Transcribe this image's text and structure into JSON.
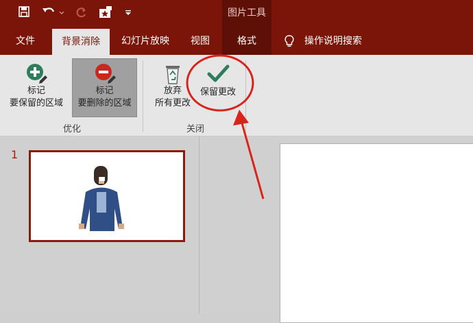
{
  "title_bar": {
    "context_group": "图片工具",
    "qat_icons": [
      "save-icon",
      "undo-icon",
      "redo-icon",
      "picture-icon",
      "customize-qat-icon"
    ]
  },
  "tabs": {
    "file": "文件",
    "background_removal": "背景消除",
    "slideshow": "幻灯片放映",
    "view": "视图",
    "format": "格式",
    "tell_me": "操作说明搜索"
  },
  "ribbon": {
    "mark_keep": [
      "标记",
      "要保留的区域"
    ],
    "mark_remove": [
      "标记",
      "要删除的区域"
    ],
    "discard": [
      "放弃",
      "所有更改"
    ],
    "keep_changes": "保留更改",
    "group_refine": "优化",
    "group_close": "关闭"
  },
  "slides_pane": {
    "slide_number": "1"
  },
  "colors": {
    "title_bar": "#7b1409",
    "active_tab_text": "#7b1409",
    "annotation_red": "#d8241a",
    "checkmark": "#2e7d5b"
  }
}
